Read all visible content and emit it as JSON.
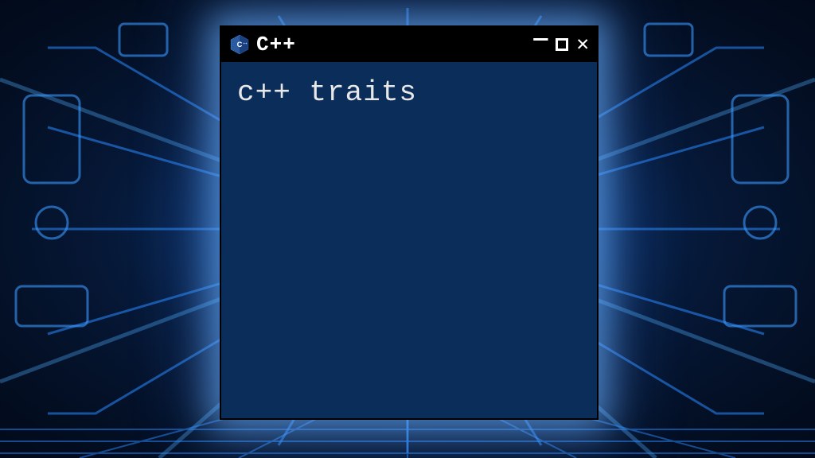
{
  "titlebar": {
    "icon_name": "cpp-hexagon-icon",
    "title": "C++"
  },
  "window_controls": {
    "minimize": "—",
    "maximize": "",
    "close": "✕"
  },
  "content": {
    "text": "c++ traits"
  }
}
